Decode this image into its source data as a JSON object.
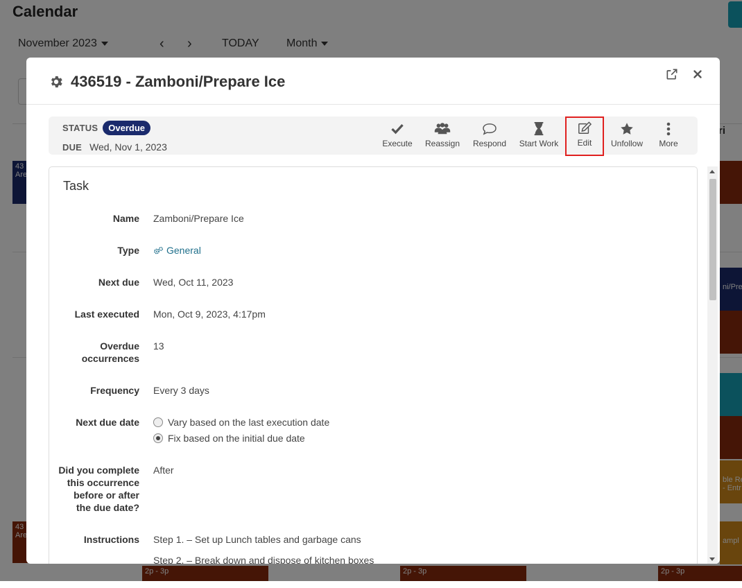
{
  "background": {
    "page_title": "Calendar",
    "month_select": "November 2023",
    "today_label": "TODAY",
    "view_select": "Month",
    "col_header_fri": "ri",
    "events": [
      {
        "text": "43",
        "sub": "Are",
        "color": "#1a2a6c"
      },
      {
        "text": "43",
        "sub": "Are",
        "color": "#8a2a0c"
      },
      {
        "text": "2p - 3p",
        "color": "#8a2a0c"
      },
      {
        "text": "2p - 3p",
        "color": "#8a2a0c"
      },
      {
        "text": "2p - 3p",
        "color": "#8a2a0c"
      },
      {
        "text": "ni/Pre",
        "color": "#1a2a6c"
      },
      {
        "text": "ble Re",
        "sub": "- Entr",
        "color": "#d38a1a"
      },
      {
        "text": "ampl",
        "color": "#d38a1a"
      }
    ]
  },
  "modal": {
    "title": "436519 - Zamboni/Prepare Ice",
    "status_label": "STATUS",
    "status_value": "Overdue",
    "due_label": "DUE",
    "due_value": "Wed, Nov 1, 2023",
    "actions": [
      {
        "label": "Execute",
        "icon": "check-icon"
      },
      {
        "label": "Reassign",
        "icon": "users-icon"
      },
      {
        "label": "Respond",
        "icon": "comment-icon"
      },
      {
        "label": "Start Work",
        "icon": "hourglass-icon"
      },
      {
        "label": "Edit",
        "icon": "edit-icon"
      },
      {
        "label": "Unfollow",
        "icon": "star-icon"
      },
      {
        "label": "More",
        "icon": "more-vertical-icon"
      }
    ],
    "colors": {
      "badge": "#1a2a6c",
      "link": "#1f6f8b",
      "highlight": "#e0201f"
    }
  },
  "task": {
    "section_title": "Task",
    "name_label": "Name",
    "name_value": "Zamboni/Prepare Ice",
    "type_label": "Type",
    "type_value": "General",
    "next_due_label": "Next due",
    "next_due_value": "Wed, Oct 11, 2023",
    "last_executed_label": "Last executed",
    "last_executed_value": "Mon, Oct 9, 2023, 4:17pm",
    "overdue_label_1": "Overdue",
    "overdue_label_2": "occurrences",
    "overdue_value": "13",
    "frequency_label": "Frequency",
    "frequency_value": "Every 3 days",
    "next_due_date_label": "Next due date",
    "next_due_date_options": [
      {
        "label": "Vary based on the last execution date",
        "selected": false
      },
      {
        "label": "Fix based on the initial due date",
        "selected": true
      }
    ],
    "complete_label_1": "Did you complete",
    "complete_label_2": "this occurrence",
    "complete_label_3": "before or after",
    "complete_label_4": "the due date?",
    "complete_value": "After",
    "instructions_label": "Instructions",
    "instructions_step1": "Step 1. – Set up Lunch tables and garbage cans",
    "instructions_step2": "Step 2. – Break down and dispose of kitchen boxes"
  }
}
